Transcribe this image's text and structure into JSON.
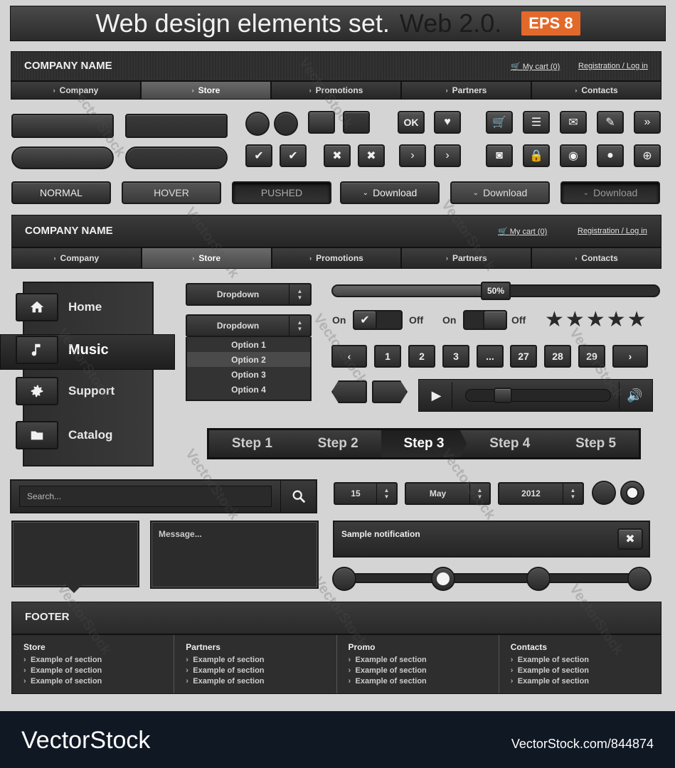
{
  "banner": {
    "title": "Web design elements set.",
    "subtitle": "Web 2.0.",
    "badge": "EPS 8"
  },
  "header": {
    "company": "COMPANY NAME",
    "cart": "My cart (0)",
    "register": "Registration / Log in"
  },
  "nav": {
    "items": [
      {
        "label": "Company"
      },
      {
        "label": "Store"
      },
      {
        "label": "Promotions"
      },
      {
        "label": "Partners"
      },
      {
        "label": "Contacts"
      }
    ],
    "active": "Store"
  },
  "buttons": {
    "ok": "OK",
    "normal": "NORMAL",
    "hover": "HOVER",
    "pushed": "PUSHED",
    "download": "Download"
  },
  "side_menu": {
    "items": [
      {
        "label": "Home",
        "icon": "home-icon"
      },
      {
        "label": "Music",
        "icon": "music-icon"
      },
      {
        "label": "Support",
        "icon": "gear-icon"
      },
      {
        "label": "Catalog",
        "icon": "folder-icon"
      }
    ],
    "active": "Music"
  },
  "dropdown": {
    "label": "Dropdown",
    "options": [
      "Option 1",
      "Option 2",
      "Option 3",
      "Option 4"
    ],
    "selected": "Option 2"
  },
  "slider": {
    "value_label": "50%",
    "value": 0.5
  },
  "toggles": [
    {
      "on": "On",
      "off": "Off",
      "state": "on"
    },
    {
      "on": "On",
      "off": "Off",
      "state": "off"
    }
  ],
  "rating": {
    "stars": 5
  },
  "pagination": {
    "pages": [
      "1",
      "2",
      "3",
      "...",
      "27",
      "28",
      "29"
    ]
  },
  "steps": {
    "items": [
      "Step 1",
      "Step 2",
      "Step 3",
      "Step 4",
      "Step 5"
    ],
    "active": "Step 3"
  },
  "search": {
    "placeholder": "Search..."
  },
  "message": {
    "placeholder": "Message..."
  },
  "date": {
    "day": "15",
    "month": "May",
    "year": "2012"
  },
  "notification": {
    "text": "Sample notification"
  },
  "footer": {
    "title": "FOOTER",
    "columns": [
      {
        "title": "Store",
        "links": [
          "Example of section",
          "Example of section",
          "Example of section"
        ]
      },
      {
        "title": "Partners",
        "links": [
          "Example of section",
          "Example of section",
          "Example of section"
        ]
      },
      {
        "title": "Promo",
        "links": [
          "Example of section",
          "Example of section",
          "Example of section"
        ]
      },
      {
        "title": "Contacts",
        "links": [
          "Example of section",
          "Example of section",
          "Example of section"
        ]
      }
    ]
  },
  "stock": {
    "logo": "VectorStock",
    "url": "VectorStock.com/844874",
    "watermark": "VectorStock"
  },
  "colors": {
    "accent": "#e3692a",
    "dark": "#2c2c2c",
    "background": "#d4d4d4"
  }
}
